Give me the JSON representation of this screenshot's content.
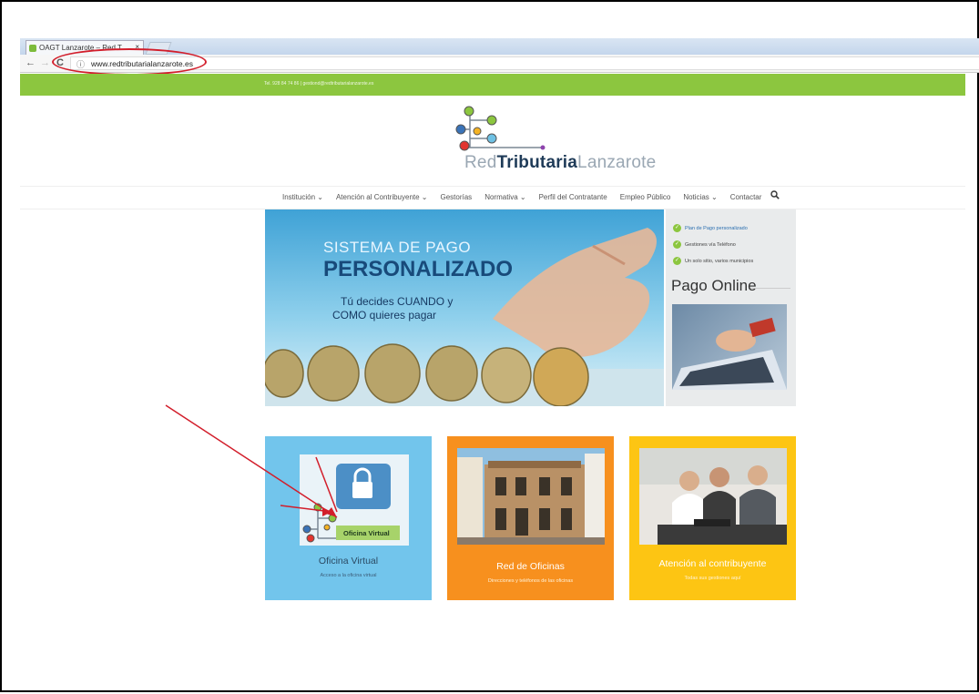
{
  "browser": {
    "tab_title": "OAGT Lanzarote – Red T",
    "tab_close": "×",
    "back_icon": "←",
    "forward_icon": "→",
    "reload_icon": "C",
    "url": "www.redtributarialanzarote.es",
    "info_icon": "ⓘ"
  },
  "site": {
    "topbar_text": "Tel. 928 84 74 86  |  gestiond@redtributarialanzarote.es",
    "logo": {
      "part1": "Red",
      "part2": "Tributaria",
      "part3": "Lanzarote"
    },
    "nav": [
      "Institución ⌄",
      "Atención al Contribuyente ⌄",
      "Gestorías",
      "Normativa ⌄",
      "Perfil del Contratante",
      "Empleo Público",
      "Noticias ⌄",
      "Contactar"
    ],
    "search_icon": "🔍",
    "banner": {
      "line1": "SISTEMA DE PAGO",
      "line2": "PERSONALIZADO",
      "line3": "Tú decides CUANDO y",
      "line4": "COMO quieres pagar"
    },
    "sidebar": {
      "items": [
        "Plan de Pago personalizado",
        "Gestiones vía Teléfono",
        "Un solo sitio, varios municipios"
      ],
      "pago_title": "Pago Online"
    },
    "tiles": [
      {
        "title": "Oficina Virtual",
        "subtitle": "Acceso a la oficina virtual",
        "image_label": "Oficina Virtual"
      },
      {
        "title": "Red de Oficinas",
        "subtitle": "Direcciones y teléfonos de las oficinas"
      },
      {
        "title": "Atención al contribuyente",
        "subtitle": "Todas sus gestiones aquí"
      }
    ]
  },
  "colors": {
    "green": "#8cc63f",
    "blue_tile": "#72c5ec",
    "orange_tile": "#f7901e",
    "yellow_tile": "#fdc513",
    "annotation_red": "#d21e2b"
  }
}
